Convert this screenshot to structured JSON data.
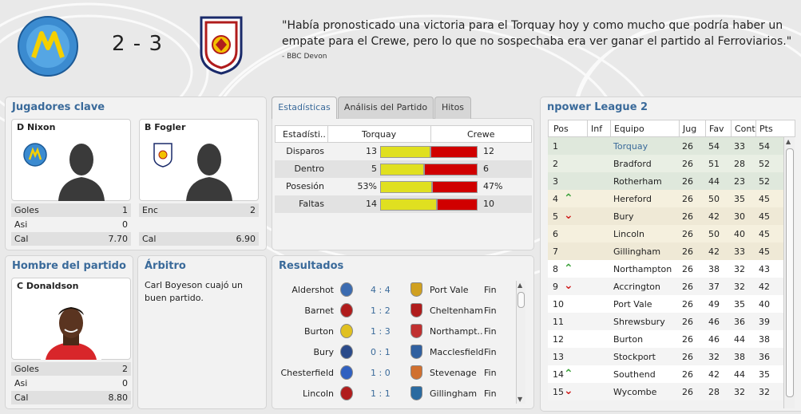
{
  "header": {
    "home_logo_text": "TORQUAY UNITED FOOTBALL CLUB",
    "away_logo_text": "CREWE ALEXANDRA FOOTBALL CLUB",
    "score": "2 - 3",
    "quote": "\"Había pronosticado una victoria para el Torquay hoy y como mucho que podría haber un empate para el Crewe, pero lo que no sospechaba era ver ganar el partido al Ferroviarios.\"",
    "quote_source": "- BBC Devon"
  },
  "key_players": {
    "title": "Jugadores clave",
    "home": {
      "name": "D Nixon",
      "stats": [
        {
          "label": "Goles",
          "value": "1"
        },
        {
          "label": "Asi",
          "value": "0"
        },
        {
          "label": "Cal",
          "value": "7.70"
        }
      ]
    },
    "away": {
      "name": "B Fogler",
      "stats": [
        {
          "label": "Enc",
          "value": "2"
        },
        {
          "label": "",
          "value": ""
        },
        {
          "label": "Cal",
          "value": "6.90"
        }
      ]
    }
  },
  "motm": {
    "title": "Hombre del partido",
    "name": "C Donaldson",
    "stats": [
      {
        "label": "Goles",
        "value": "2"
      },
      {
        "label": "Asi",
        "value": "0"
      },
      {
        "label": "Cal",
        "value": "8.80"
      }
    ]
  },
  "referee": {
    "title": "Árbitro",
    "text": "Carl Boyeson cuajó un buen partido."
  },
  "tabs": [
    {
      "label": "Estadísticas",
      "active": true
    },
    {
      "label": "Análisis del Partido",
      "active": false
    },
    {
      "label": "Hitos",
      "active": false
    }
  ],
  "match_stats": {
    "headers": [
      "Estadísti..",
      "Torquay",
      "Crewe"
    ],
    "colors": {
      "home": "#e0e020",
      "away": "#d00000"
    },
    "rows": [
      {
        "label": "Disparos",
        "home": "13",
        "away": "12",
        "home_share": 0.52
      },
      {
        "label": "Dentro",
        "home": "5",
        "away": "6",
        "home_share": 0.45
      },
      {
        "label": "Posesión",
        "home": "53%",
        "away": "47%",
        "home_share": 0.53
      },
      {
        "label": "Faltas",
        "home": "14",
        "away": "10",
        "home_share": 0.58
      }
    ]
  },
  "results": {
    "title": "Resultados",
    "rows": [
      {
        "home": "Aldershot",
        "score": "4 : 4",
        "away": "Port Vale",
        "status": "Fin"
      },
      {
        "home": "Barnet",
        "score": "1 : 2",
        "away": "Cheltenham",
        "status": "Fin"
      },
      {
        "home": "Burton",
        "score": "1 : 3",
        "away": "Northampt..",
        "status": "Fin"
      },
      {
        "home": "Bury",
        "score": "0 : 1",
        "away": "Macclesfield",
        "status": "Fin"
      },
      {
        "home": "Chesterfield",
        "score": "1 : 0",
        "away": "Stevenage",
        "status": "Fin"
      },
      {
        "home": "Lincoln",
        "score": "1 : 1",
        "away": "Gillingham",
        "status": "Fin"
      }
    ]
  },
  "league": {
    "title": "npower League 2",
    "headers": [
      "Pos",
      "Inf",
      "Equipo",
      "Jug",
      "Fav",
      "Cont",
      "Pts"
    ],
    "rows": [
      {
        "pos": "1",
        "trend": "",
        "team": "Torquay",
        "p": "26",
        "f": "54",
        "a": "33",
        "pts": "54",
        "zone": "promo",
        "highlight": true
      },
      {
        "pos": "2",
        "trend": "",
        "team": "Bradford",
        "p": "26",
        "f": "51",
        "a": "28",
        "pts": "52",
        "zone": "promo"
      },
      {
        "pos": "3",
        "trend": "",
        "team": "Rotherham",
        "p": "26",
        "f": "44",
        "a": "23",
        "pts": "52",
        "zone": "promo"
      },
      {
        "pos": "4",
        "trend": "up",
        "team": "Hereford",
        "p": "26",
        "f": "50",
        "a": "35",
        "pts": "45",
        "zone": "playoff"
      },
      {
        "pos": "5",
        "trend": "down",
        "team": "Bury",
        "p": "26",
        "f": "42",
        "a": "30",
        "pts": "45",
        "zone": "playoff"
      },
      {
        "pos": "6",
        "trend": "",
        "team": "Lincoln",
        "p": "26",
        "f": "50",
        "a": "40",
        "pts": "45",
        "zone": "playoff"
      },
      {
        "pos": "7",
        "trend": "",
        "team": "Gillingham",
        "p": "26",
        "f": "42",
        "a": "33",
        "pts": "45",
        "zone": "playoff"
      },
      {
        "pos": "8",
        "trend": "up",
        "team": "Northampton",
        "p": "26",
        "f": "38",
        "a": "32",
        "pts": "43",
        "zone": ""
      },
      {
        "pos": "9",
        "trend": "down",
        "team": "Accrington",
        "p": "26",
        "f": "37",
        "a": "32",
        "pts": "42",
        "zone": ""
      },
      {
        "pos": "10",
        "trend": "",
        "team": "Port Vale",
        "p": "26",
        "f": "49",
        "a": "35",
        "pts": "40",
        "zone": ""
      },
      {
        "pos": "11",
        "trend": "",
        "team": "Shrewsbury",
        "p": "26",
        "f": "46",
        "a": "36",
        "pts": "39",
        "zone": ""
      },
      {
        "pos": "12",
        "trend": "",
        "team": "Burton",
        "p": "26",
        "f": "46",
        "a": "44",
        "pts": "38",
        "zone": ""
      },
      {
        "pos": "13",
        "trend": "",
        "team": "Stockport",
        "p": "26",
        "f": "32",
        "a": "38",
        "pts": "36",
        "zone": ""
      },
      {
        "pos": "14",
        "trend": "up",
        "team": "Southend",
        "p": "26",
        "f": "42",
        "a": "44",
        "pts": "35",
        "zone": ""
      },
      {
        "pos": "15",
        "trend": "down",
        "team": "Wycombe",
        "p": "26",
        "f": "28",
        "a": "32",
        "pts": "32",
        "zone": ""
      }
    ]
  }
}
